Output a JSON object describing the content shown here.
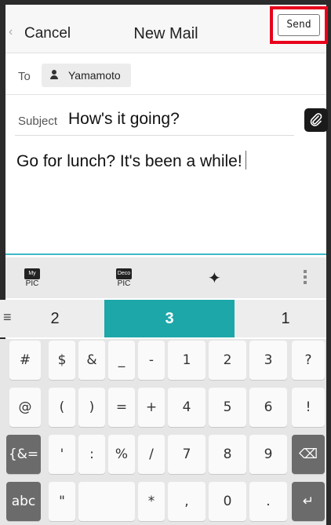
{
  "header": {
    "cancel_label": "Cancel",
    "title": "New Mail",
    "send_label": "Send",
    "highlight_color": "#e8001c"
  },
  "to": {
    "label": "To",
    "recipient": "Yamamoto"
  },
  "subject": {
    "label": "Subject",
    "value": "How's it going?"
  },
  "body": {
    "text": "Go for lunch? It's been a while!"
  },
  "toolbar": {
    "my_pic_badge": "My",
    "my_pic_label": "PIC",
    "deco_pic_badge": "Deco",
    "deco_pic_label": "PIC",
    "sparkle": "✦",
    "more_icon": "vertical-dots-icon"
  },
  "candidates": {
    "menu": "≡",
    "left": "2",
    "center": "3",
    "right": "1",
    "active_color": "#1ea7a9"
  },
  "keyboard": {
    "row1": [
      "#",
      "$",
      "&",
      "_",
      "-",
      "1",
      "2",
      "3",
      "?"
    ],
    "row2": [
      "@",
      "(",
      ")",
      "=",
      "+",
      "4",
      "5",
      "6",
      "!"
    ],
    "row3": [
      "{&=",
      "'",
      ":",
      "%",
      "/",
      "7",
      "8",
      "9",
      "⌫"
    ],
    "row4": [
      "abc",
      "\"",
      "",
      "*",
      ",",
      "0",
      ".",
      "↵"
    ]
  }
}
